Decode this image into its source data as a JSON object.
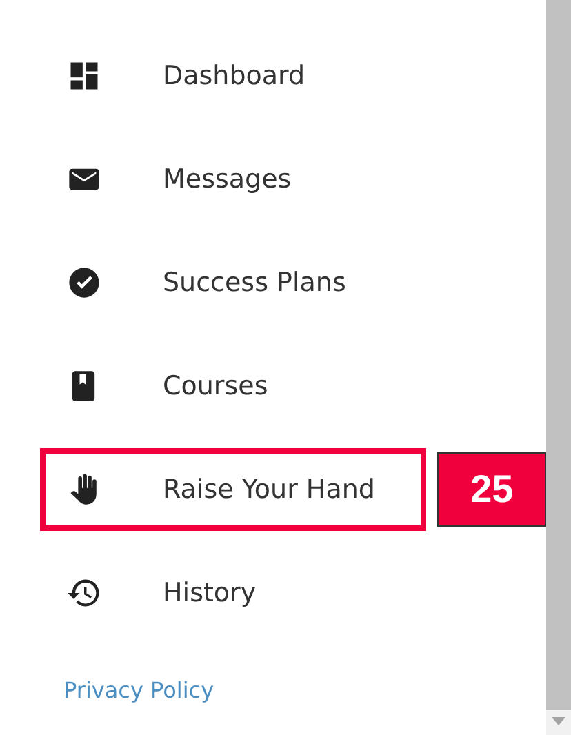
{
  "nav": {
    "items": [
      {
        "label": "Dashboard",
        "highlighted": false
      },
      {
        "label": "Messages",
        "highlighted": false
      },
      {
        "label": "Success Plans",
        "highlighted": false
      },
      {
        "label": "Courses",
        "highlighted": false
      },
      {
        "label": "Raise Your Hand",
        "highlighted": true,
        "badge": "25"
      },
      {
        "label": "History",
        "highlighted": false
      }
    ]
  },
  "footer": {
    "link": "Privacy Policy"
  }
}
